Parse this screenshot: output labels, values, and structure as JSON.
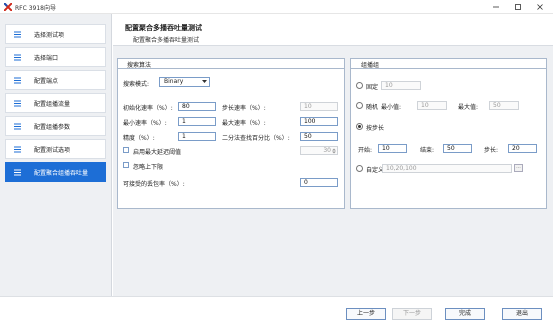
{
  "window": {
    "title": "RFC 3918向导"
  },
  "sidebar": {
    "items": [
      {
        "label": "选择测试项"
      },
      {
        "label": "选择端口"
      },
      {
        "label": "配置端点"
      },
      {
        "label": "配置组播流量"
      },
      {
        "label": "配置组播参数"
      },
      {
        "label": "配置测试选项"
      },
      {
        "label": "配置聚合组播吞吐量"
      }
    ],
    "active_index": 6
  },
  "header": {
    "title": "配置聚合多播吞吐量测试",
    "subtitle": "配置聚合多播吞吐量测试"
  },
  "search": {
    "heading": "搜索算法",
    "mode_label": "搜索模式:",
    "mode_value": "Binary",
    "init_rate_label": "初始化速率（%）:",
    "init_rate_value": "80",
    "step_rate_label": "步长速率（%）:",
    "step_rate_value": "10",
    "min_rate_label": "最小速率（%）:",
    "min_rate_value": "1",
    "max_rate_label": "最大速率（%）:",
    "max_rate_value": "100",
    "precision_label": "精度（%）:",
    "precision_value": "1",
    "binary_ratio_label": "二分法查找百分比（%）:",
    "binary_ratio_value": "50",
    "use_max_delay_label": "启用最大延迟阈值",
    "max_delay_value": "30",
    "ignore_bounds_label": "忽略上下限",
    "acceptable_loss_label": "可接受的丢包率（%）:",
    "acceptable_loss_value": "0"
  },
  "group": {
    "heading": "组播组",
    "fixed_label": "固定",
    "fixed_value": "10",
    "random_label": "随机",
    "random_min_label": "最小值:",
    "random_min_value": "10",
    "random_max_label": "最大值:",
    "random_max_value": "50",
    "step_label": "按步长",
    "start_label": "开始:",
    "start_value": "10",
    "end_label": "结束:",
    "end_value": "50",
    "step_size_label": "步长:",
    "step_size_value": "20",
    "custom_label": "自定义",
    "custom_value": "10,20,100",
    "browse_label": "...",
    "selected": "step"
  },
  "footer": {
    "prev_label": "上一步",
    "next_label": "下一步",
    "finish_label": "完成",
    "exit_label": "退出"
  },
  "colors": {
    "accent": "#1d6ed6",
    "panel_border": "#a9b8cc",
    "sidebar_bg": "#eef0f3"
  }
}
